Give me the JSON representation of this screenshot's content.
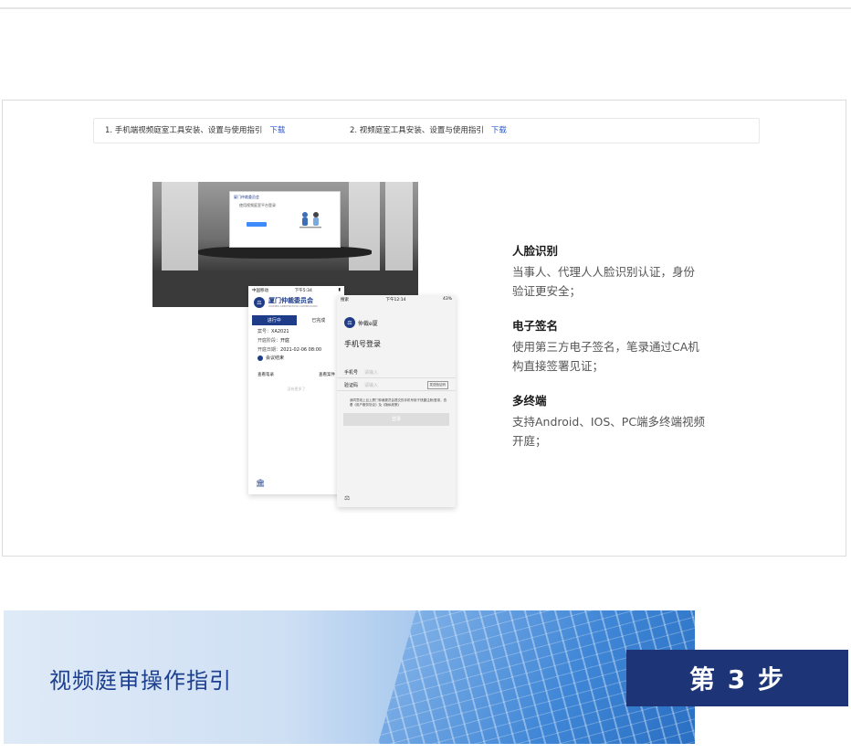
{
  "downloads": [
    {
      "text": "1. 手机端视频庭室工具安装、设置与使用指引",
      "link": "下载"
    },
    {
      "text": "2. 视频庭室工具安装、设置与使用指引",
      "link": "下载"
    }
  ],
  "laptop": {
    "brand": "厦门仲裁委员会",
    "login": "使用视频庭室平台登录"
  },
  "phone_a": {
    "status_left": "中国移动",
    "status_mid": "下午5:34",
    "title": "厦门仲裁委员会",
    "subtitle": "XIAMEN ARBITRATION COMMISSION",
    "tab_active": "进行中",
    "tab_other": "已完成",
    "case_label": "案号：",
    "case_value": "XA2021",
    "phase_label": "开庭阶段：",
    "phase_value": "开庭",
    "date_label": "开庭日期：",
    "date_value": "2021-02-06 08:00",
    "meeting": "会议结束",
    "btn_record": "查看笔录",
    "btn_case": "查看案件",
    "more": "没有更多了"
  },
  "phone_b": {
    "status_left": "搜索",
    "status_mid": "下午12:14",
    "status_right": "43%",
    "brand": "仲裁e厦",
    "title": "手机号登录",
    "phone_label": "手机号",
    "phone_ph": "请输入",
    "code_label": "验证码",
    "code_ph": "请输入",
    "code_btn": "发送验证码",
    "agree": "我同意线上且上厦门仲裁委员会提交的手机号用于快捷注册/登录，查看《用户服务协议》及《隐私政策》",
    "login": "登录"
  },
  "features": [
    {
      "title": "人脸识别",
      "desc": "当事人、代理人人脸识别认证，身份验证更安全；"
    },
    {
      "title": "电子签名",
      "desc": "使用第三方电子签名，笔录通过CA机构直接签署见证；"
    },
    {
      "title": "多终端",
      "desc": "支持Android、IOS、PC端多终端视频开庭；"
    }
  ],
  "banner": {
    "title": "视频庭审操作指引",
    "step": "第 3 步"
  },
  "colors": {
    "link": "#2b5bd7",
    "navy": "#1d3576",
    "brand": "#1f3c88"
  }
}
